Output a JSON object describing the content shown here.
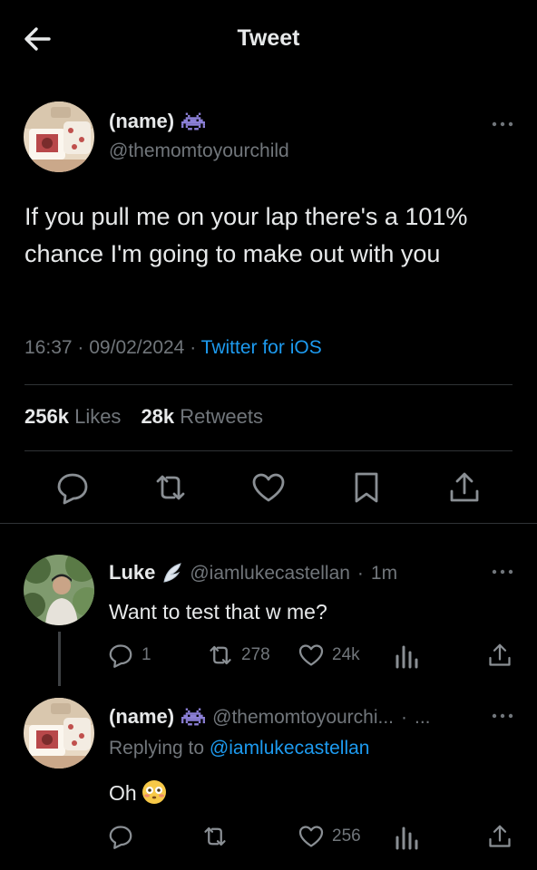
{
  "header": {
    "title": "Tweet"
  },
  "main_tweet": {
    "author_name": "(name)",
    "handle": "@themomtoyourchild",
    "text": "If you pull me on your lap there's a 101% chance I'm going to make out with you",
    "time": "16:37",
    "date": "09/02/2024",
    "source": "Twitter for iOS",
    "likes_count": "256k",
    "likes_label": "Likes",
    "retweets_count": "28k",
    "retweets_label": "Retweets"
  },
  "replies": [
    {
      "author_name": "Luke",
      "handle": "@iamlukecastellan",
      "time": "1m",
      "text": "Want to test that w me?",
      "reply_count": "1",
      "retweet_count": "278",
      "like_count": "24k"
    },
    {
      "author_name": "(name)",
      "handle": "@themomtoyourchi...",
      "time": "...",
      "replying_to_label": "Replying to",
      "replying_to_handle": "@iamlukecastellan",
      "text": "Oh",
      "reply_count": "",
      "retweet_count": "",
      "like_count": "256"
    }
  ],
  "icons": {
    "back": "arrow-left-icon",
    "more": "more-dots-icon",
    "reply": "reply-icon",
    "retweet": "retweet-icon",
    "like": "heart-icon",
    "bookmark": "bookmark-icon",
    "share": "share-icon",
    "views": "views-icon",
    "badge": "space-invader-icon",
    "wing": "wing-icon",
    "emoji": "flushed-face-icon"
  },
  "colors": {
    "background": "#000000",
    "text": "#e7e9ea",
    "muted": "#71767b",
    "accent": "#1d9bf0",
    "divider": "#2f3336",
    "badge": "#8b7fd6"
  }
}
